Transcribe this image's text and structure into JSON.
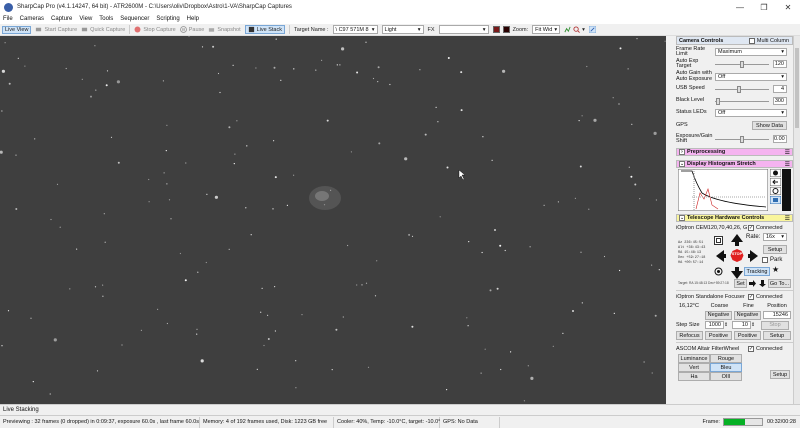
{
  "window": {
    "title": "SharpCap Pro (v4.1.14247, 64 bit) - ATR2600M - C:\\Users\\oliv\\Dropbox\\Astro\\1-VA\\SharpCap Captures",
    "controls": [
      "—",
      "❐",
      "✕"
    ]
  },
  "menu": [
    "File",
    "Cameras",
    "Capture",
    "View",
    "Tools",
    "Sequencer",
    "Scripting",
    "Help"
  ],
  "toolbar": {
    "live_view": "Live View",
    "start_capture": "Start Capture",
    "quick_capture": "Quick Capture",
    "stop_capture": "Stop Capture",
    "pause": "Pause",
    "snapshot": "Snapshot",
    "live_stack": "Live Stack",
    "target_name_label": "Target Name :",
    "target_name_value": "\\ C97 571M 8",
    "frame_type": "Light",
    "fx_label": "FX",
    "fx_value": "",
    "zoom_label": "Zoom:",
    "zoom_value": "Fit Wid",
    "swatch_colors": [
      "#7a1a1a",
      "#2a0000"
    ]
  },
  "camera_controls": {
    "header": "Camera Controls",
    "multi_column": "Multi Column",
    "frame_rate_label": "Frame Rate Limit",
    "frame_rate_value": "Maximum",
    "auto_exp_target_label": "Auto Exp Target",
    "auto_exp_target_value": "120",
    "auto_gain_label": "Auto Gain with Auto Exposure",
    "auto_gain_value": "Off",
    "usb_speed_label": "USB Speed",
    "usb_speed_value": "4",
    "black_level_label": "Black Level",
    "black_level_value": "300",
    "status_leds_label": "Status LEDs",
    "status_leds_value": "Off",
    "gps_label": "GPS",
    "show_data": "Show Data",
    "exposure_gain_label": "Exposure/Gain Shift",
    "exposure_gain_value": "0.00"
  },
  "preprocessing": {
    "header": "Preprocessing"
  },
  "histogram": {
    "header": "Display Histogram Stretch"
  },
  "telescope": {
    "header": "Telescope Hardware Controls",
    "mount_name": "iOptron CEM120,70,40,26, G",
    "connected_label": "Connected",
    "rate_label": "Rate:",
    "rate_value": "16x",
    "setup": "Setup",
    "stop": "STOP",
    "park": "Park",
    "tracking": "Tracking",
    "set": "Set",
    "goto": "Go To...",
    "coords": [
      "Az  236:45:51",
      "Alt  +36:43:43",
      "RA   15:48:13",
      "Dec  +59:27:18",
      "HA  +00:57:14"
    ],
    "footnote": "Target: RA 15:48:13 Dec+59:27:18",
    "focuser_name": "iOptron Standalone Focuser",
    "focuser_connected": "Connected",
    "temp": "16,12°C",
    "coarse": "Coarse",
    "fine": "Fine",
    "position_label": "Position",
    "negative": "Negative",
    "position_value": "15246",
    "step_size_label": "Step Size",
    "step_coarse": "1000",
    "step_fine": "10",
    "stop_btn": "Stop",
    "positive": "Positive",
    "refocus": "Refocus",
    "filterwheel_name": "ASCOM Altair FilterWheel",
    "filterwheel_connected": "Connected",
    "filters": [
      "Luminance",
      "Rouge",
      "Vert",
      "Bleu",
      "Ha",
      "OIII"
    ],
    "fw_setup": "Setup"
  },
  "live_stacking_tab": "Live Stacking",
  "status": {
    "preview": "Previewing : 32 frames (0 dropped) in 0:09:37, exposure 60.0s , last frame 60.0s",
    "memory": "Memory: 4 of 192 frames used, Disk: 1223 GB free",
    "cooler": "Cooler: 40%, Temp: -10.0°C, target: -10.0°",
    "gps": "GPS: No Data",
    "frame_label": "Frame:",
    "frame_time": "00:32/00:28",
    "progress_fraction": 0.55
  }
}
